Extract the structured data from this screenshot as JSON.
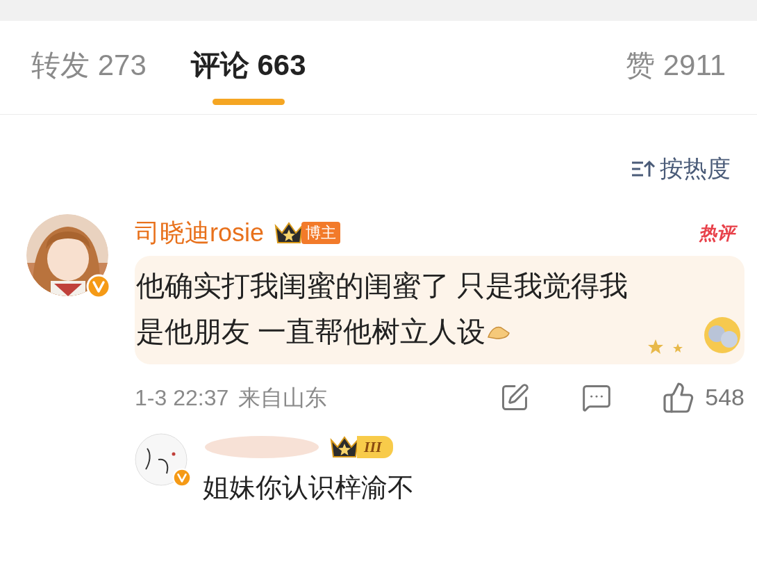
{
  "tabs": [
    {
      "label": "转发 273",
      "selected": false
    },
    {
      "label": "评论 663",
      "selected": true
    },
    {
      "label": "赞 2911",
      "selected": false
    }
  ],
  "sort": {
    "label": "按热度"
  },
  "comment": {
    "author": "司晓迪rosie",
    "badge": "博主",
    "hot_tag": "热评",
    "verified": true,
    "text_lines": [
      "他确实打我闺蜜的闺蜜了 只是我觉得我",
      "是他朋友 一直帮他树立人设"
    ],
    "time": "1-3 22:37",
    "location": "来自山东",
    "likes": "548"
  },
  "reply": {
    "level_badge": "III",
    "verified": true,
    "text": "姐妹你认识梓渝不"
  }
}
